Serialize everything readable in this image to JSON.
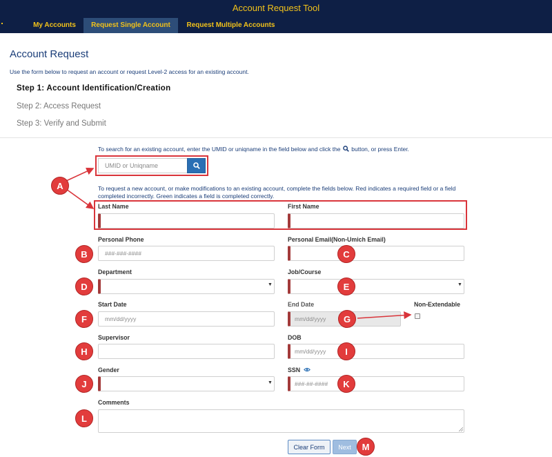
{
  "app": {
    "title": "Account Request Tool"
  },
  "nav": {
    "tabs": [
      {
        "label": "My Accounts"
      },
      {
        "label": "Request Single Account"
      },
      {
        "label": "Request Multiple Accounts"
      }
    ]
  },
  "page": {
    "title": "Account Request",
    "intro": "Use the form below to request an account or request Level-2 access for an existing account."
  },
  "steps": [
    {
      "label": "Step 1: Account Identification/Creation"
    },
    {
      "label": "Step 2: Access Request"
    },
    {
      "label": "Step 3: Verify and Submit"
    }
  ],
  "search": {
    "help_before": "To search for an existing account, enter the UMID or uniqname in the field below and click the",
    "help_after": "button, or press Enter.",
    "placeholder": "UMID or Uniqname"
  },
  "form": {
    "help": "To request a new account, or make modifications to an existing account, complete the fields below. Red indicates a required field or a field completed incorrectly. Green indicates a field is completed correctly.",
    "last_name": {
      "label": "Last Name",
      "value": ""
    },
    "first_name": {
      "label": "First Name",
      "value": ""
    },
    "personal_phone": {
      "label": "Personal Phone",
      "placeholder": "###-###-####"
    },
    "personal_email": {
      "label": "Personal Email(Non-Umich Email)",
      "value": ""
    },
    "department": {
      "label": "Department",
      "selected": ""
    },
    "job_course": {
      "label": "Job/Course",
      "selected": ""
    },
    "start_date": {
      "label": "Start Date",
      "placeholder": "mm/dd/yyyy"
    },
    "end_date": {
      "label": "End Date",
      "placeholder": "mm/dd/yyyy"
    },
    "non_extendable": {
      "label": "Non-Extendable",
      "checked": false
    },
    "supervisor": {
      "label": "Supervisor",
      "value": ""
    },
    "dob": {
      "label": "DOB",
      "placeholder": "mm/dd/yyyy"
    },
    "gender": {
      "label": "Gender",
      "selected": ""
    },
    "ssn": {
      "label": "SSN",
      "placeholder": "###-##-####"
    },
    "comments": {
      "label": "Comments",
      "value": ""
    }
  },
  "buttons": {
    "clear": "Clear Form",
    "next": "Next"
  },
  "annotations": {
    "badges": [
      "A",
      "B",
      "C",
      "D",
      "E",
      "F",
      "G",
      "H",
      "I",
      "J",
      "K",
      "L",
      "M"
    ],
    "color": "#e23c3c"
  },
  "colors": {
    "header_bg": "#0e1f45",
    "header_text": "#f2c21a",
    "active_tab": "#2d4d78",
    "required_marker": "#a33a3a",
    "primary_button": "#2a6fb4"
  }
}
